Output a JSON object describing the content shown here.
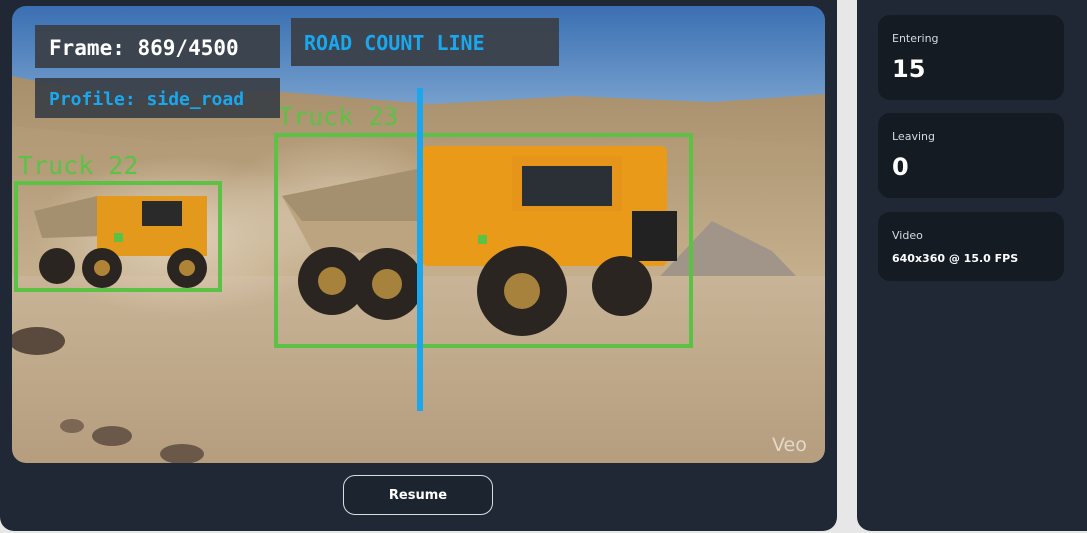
{
  "video": {
    "frame_label": "Frame: 869/4500",
    "line_label": "ROAD COUNT LINE",
    "profile_label": "Profile: side_road",
    "detections": [
      {
        "label": "Truck 22"
      },
      {
        "label": "Truck 23"
      }
    ],
    "watermark": "Veo",
    "box_color": "#5bc245",
    "line_color": "#1aa7ee"
  },
  "controls": {
    "resume_label": "Resume"
  },
  "stats": {
    "entering": {
      "label": "Entering",
      "value": "15"
    },
    "leaving": {
      "label": "Leaving",
      "value": "0"
    },
    "video": {
      "label": "Video",
      "value": "640x360 @ 15.0 FPS"
    }
  }
}
